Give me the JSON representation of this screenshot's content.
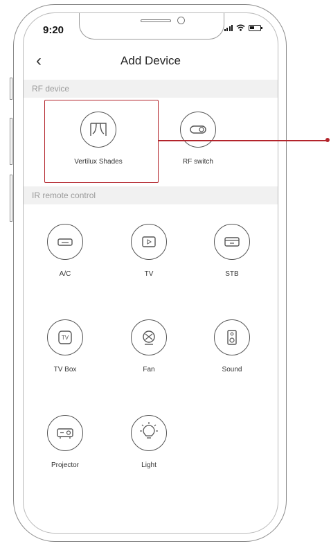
{
  "status": {
    "time": "9:20"
  },
  "nav": {
    "title": "Add Device"
  },
  "sections": {
    "rf": "RF device",
    "ir": "IR remote control"
  },
  "rf_devices": [
    {
      "label": "Vertilux Shades",
      "icon": "shades-icon"
    },
    {
      "label": "RF switch",
      "icon": "switch-icon"
    }
  ],
  "ir_devices": [
    {
      "label": "A/C",
      "icon": "ac-icon"
    },
    {
      "label": "TV",
      "icon": "tv-icon"
    },
    {
      "label": "STB",
      "icon": "stb-icon"
    },
    {
      "label": "TV Box",
      "icon": "tv-box-icon"
    },
    {
      "label": "Fan",
      "icon": "fan-icon"
    },
    {
      "label": "Sound",
      "icon": "speaker-icon"
    },
    {
      "label": "Projector",
      "icon": "projector-icon"
    },
    {
      "label": "Light",
      "icon": "light-bulb-icon"
    }
  ],
  "colors": {
    "highlight": "#b3242b",
    "section_bg": "#f1f1f1"
  }
}
